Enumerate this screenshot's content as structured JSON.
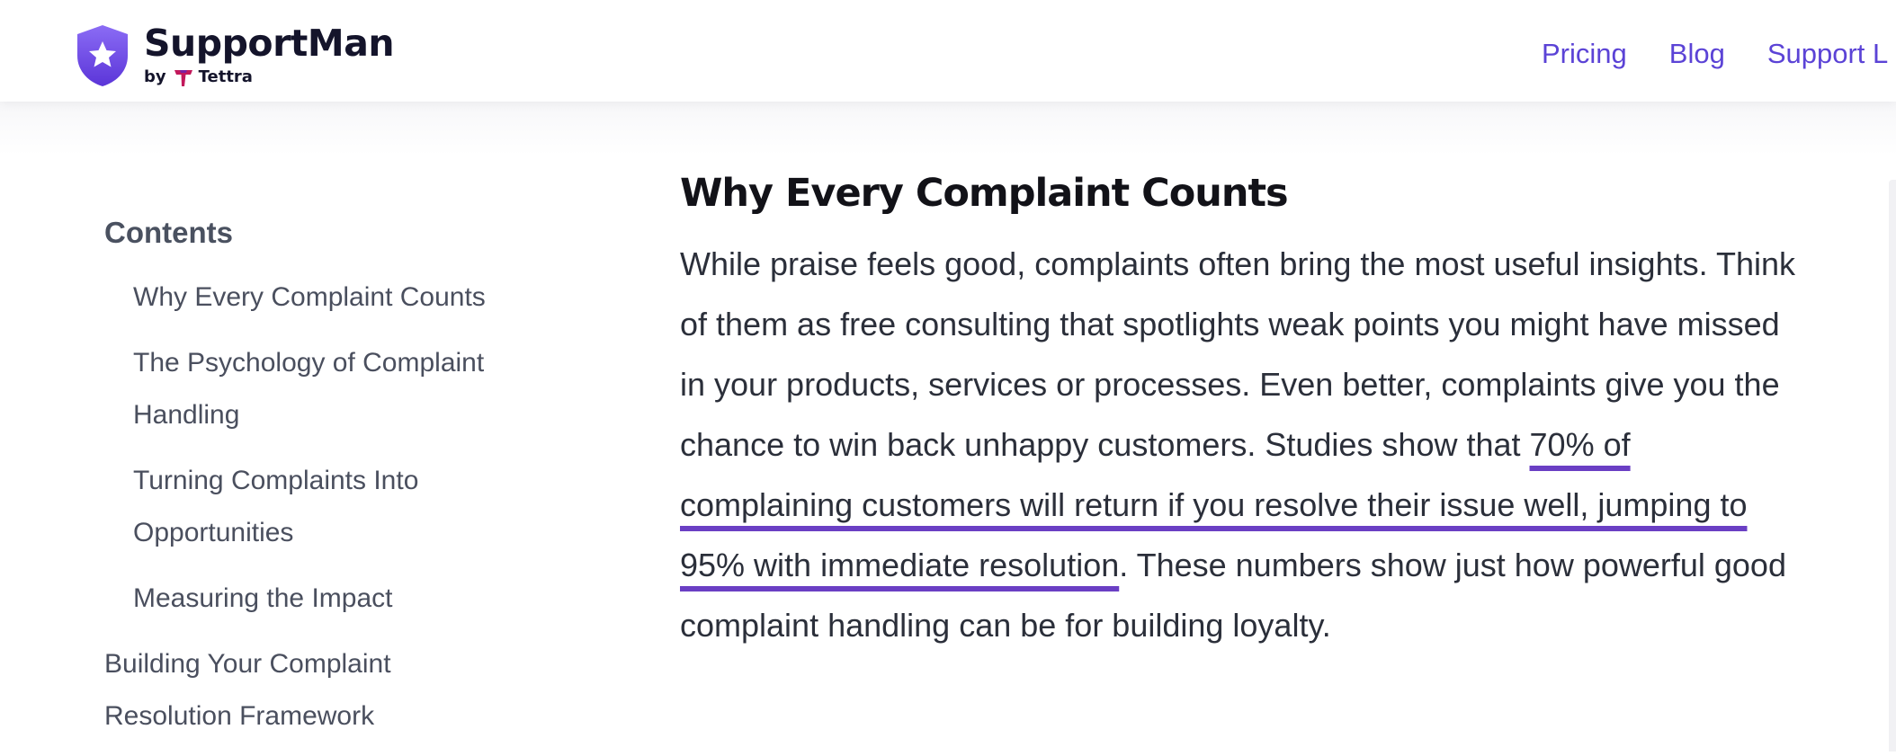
{
  "header": {
    "brand_name": "SupportMan",
    "byline_prefix": "by",
    "byline_company": "Tettra",
    "nav": [
      "Pricing",
      "Blog",
      "Support L"
    ]
  },
  "colors": {
    "accent": "#5b43d6",
    "underline": "#6a3fc4",
    "heading": "#121218",
    "body_text": "#2b2f3a"
  },
  "toc": {
    "title": "Contents",
    "items": [
      {
        "label": "Why Every Complaint Counts"
      },
      {
        "label": "The Psychology of Complaint Handling"
      },
      {
        "label": "Turning Complaints Into Opportunities"
      },
      {
        "label": "Measuring the Impact"
      },
      {
        "label": "Building Your Complaint Resolution Framework"
      }
    ]
  },
  "article": {
    "heading": "Why Every Complaint Counts",
    "para_before": "While praise feels good, complaints often bring the most useful insights. Think of them as free consulting that spotlights weak points you might have missed in your products, services or processes. Even better, complaints give you the chance to win back unhappy customers. Studies show that ",
    "para_highlight": "70% of complaining customers will return if you resolve their issue well, jumping to 95% with immediate resolution",
    "para_after": ". These numbers show just how powerful good complaint handling can be for building loyalty."
  }
}
